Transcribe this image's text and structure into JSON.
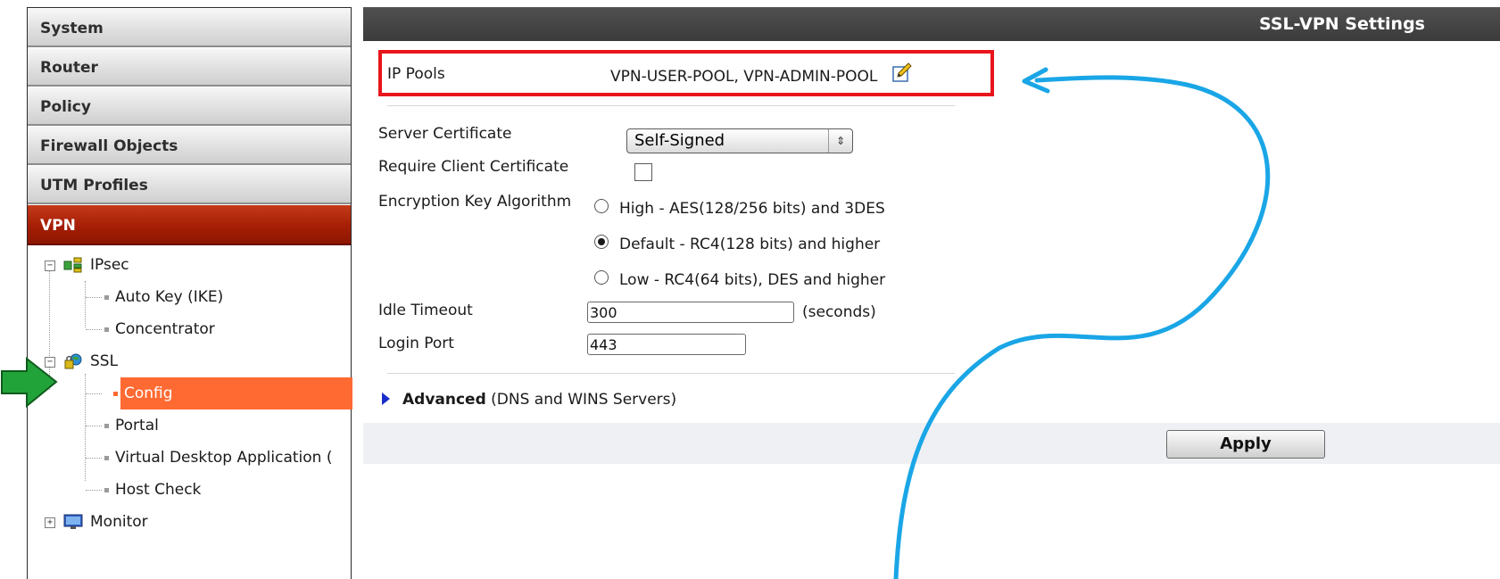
{
  "sidebar": {
    "menus": [
      {
        "label": "System"
      },
      {
        "label": "Router"
      },
      {
        "label": "Policy"
      },
      {
        "label": "Firewall Objects"
      },
      {
        "label": "UTM Profiles"
      },
      {
        "label": "VPN"
      }
    ],
    "tree": {
      "ipsec": {
        "label": "IPsec",
        "children": [
          "Auto Key (IKE)",
          "Concentrator"
        ]
      },
      "ssl": {
        "label": "SSL",
        "children": [
          "Config",
          "Portal",
          "Virtual Desktop Application (",
          "Host Check"
        ]
      },
      "monitor": {
        "label": "Monitor"
      }
    },
    "active_menu": "VPN",
    "selected_item": "Config"
  },
  "main": {
    "title": "SSL-VPN Settings",
    "ip_pools": {
      "label": "IP Pools",
      "value": "VPN-USER-POOL, VPN-ADMIN-POOL"
    },
    "server_certificate": {
      "label": "Server Certificate",
      "value": "Self-Signed"
    },
    "require_client_certificate": {
      "label": "Require Client Certificate",
      "checked": false
    },
    "encryption": {
      "label": "Encryption Key Algorithm",
      "options": [
        {
          "label": "High - AES(128/256 bits) and 3DES",
          "checked": false
        },
        {
          "label": "Default - RC4(128 bits) and higher",
          "checked": true
        },
        {
          "label": "Low - RC4(64 bits), DES and higher",
          "checked": false
        }
      ]
    },
    "idle_timeout": {
      "label": "Idle Timeout",
      "value": "300",
      "unit": "(seconds)"
    },
    "login_port": {
      "label": "Login Port",
      "value": "443"
    },
    "advanced": {
      "label": "Advanced",
      "sub": "(DNS and WINS Servers)"
    },
    "apply_label": "Apply"
  },
  "colors": {
    "active_menu": "#a51e05",
    "selected_item": "#ff6a33",
    "highlight_box": "#e8151c",
    "annotation_arrow": "#1aa6e6",
    "pointer_arrow": "#22a33a"
  },
  "icons": {
    "edit": "pencil-edit-icon",
    "ipsec": "network-icon",
    "ssl": "globe-lock-icon",
    "monitor": "monitor-icon"
  }
}
